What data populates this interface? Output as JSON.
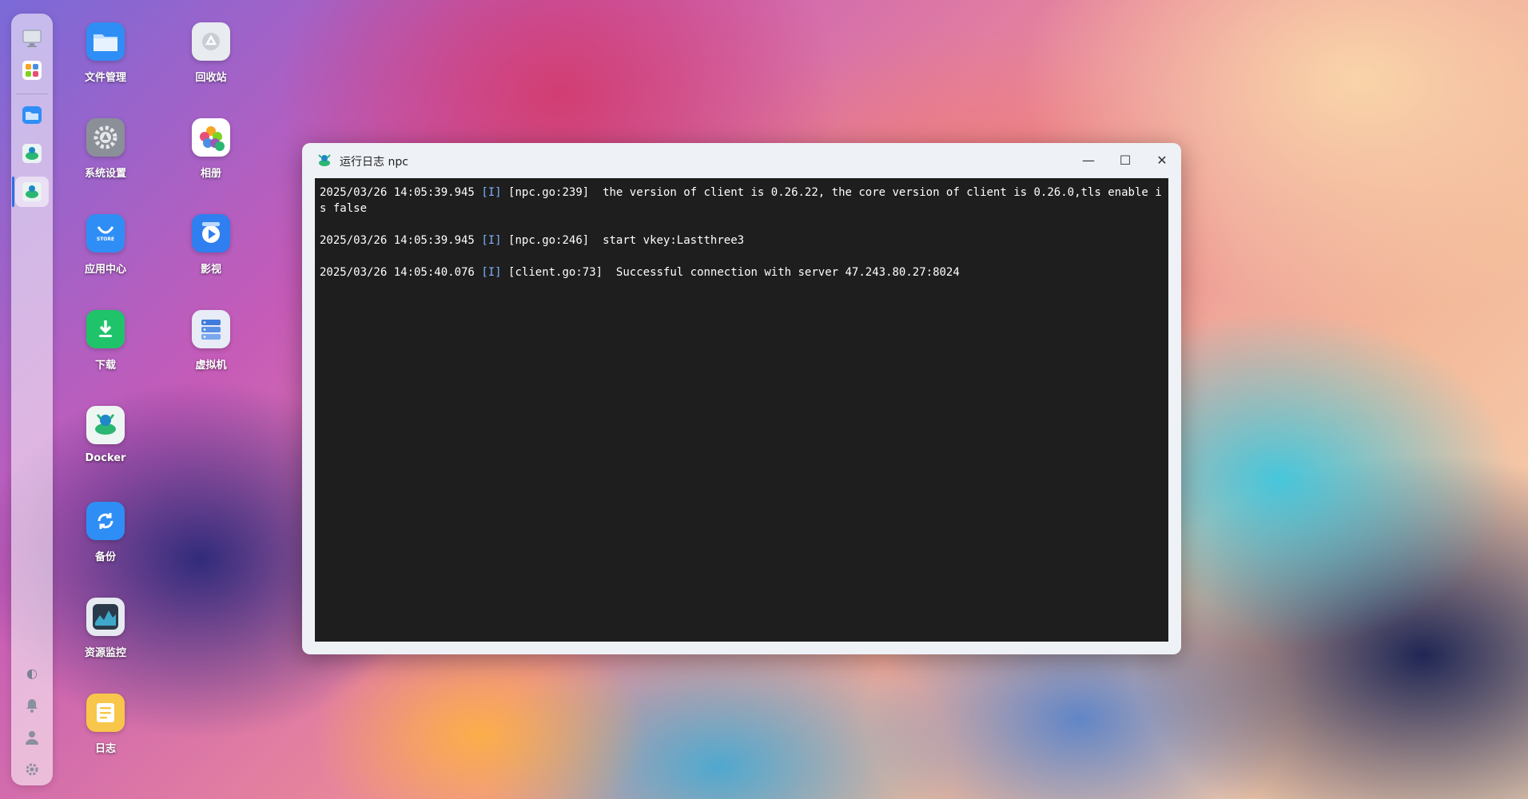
{
  "desktop": {
    "icons": [
      {
        "label": "文件管理",
        "icon": "folder-icon"
      },
      {
        "label": "回收站",
        "icon": "recycle-bin-icon"
      },
      {
        "label": "系统设置",
        "icon": "settings-gear-icon"
      },
      {
        "label": "相册",
        "icon": "photos-icon"
      },
      {
        "label": "应用中心",
        "icon": "app-store-icon",
        "badge": "STORE"
      },
      {
        "label": "影视",
        "icon": "video-icon"
      },
      {
        "label": "下载",
        "icon": "download-icon"
      },
      {
        "label": "虚拟机",
        "icon": "virtual-machine-icon"
      },
      {
        "label": "Docker",
        "icon": "docker-icon"
      },
      {
        "label": "备份",
        "icon": "backup-icon"
      },
      {
        "label": "资源监控",
        "icon": "resource-monitor-icon"
      },
      {
        "label": "日志",
        "icon": "log-icon"
      }
    ]
  },
  "dock": {
    "items": [
      "desktop-icon",
      "apps-grid-icon",
      "folder-icon",
      "docker-icon",
      "npc-app-icon"
    ],
    "active_index": 4,
    "system_items": [
      "theme-icon",
      "bell-icon",
      "user-icon",
      "gear-icon"
    ]
  },
  "window": {
    "title": "运行日志 npc",
    "minimize": "—",
    "maximize": "☐",
    "close": "✕",
    "log_lines": [
      {
        "timestamp": "2025/03/26 14:05:39.945",
        "level": "[I]",
        "source": "[npc.go:239]",
        "message": " the version of client is 0.26.22, the core version of client is 0.26.0,tls enable is false"
      },
      {
        "timestamp": "2025/03/26 14:05:39.945",
        "level": "[I]",
        "source": "[npc.go:246]",
        "message": " start vkey:Lastthree3"
      },
      {
        "timestamp": "2025/03/26 14:05:40.076",
        "level": "[I]",
        "source": "[client.go:73]",
        "message": " Successful connection with server 47.243.80.27:8024"
      }
    ]
  },
  "colors": {
    "console_bg": "#1e1e1e",
    "level_tag": "#7fb0ff",
    "dock_active": "#2b6fe0"
  }
}
